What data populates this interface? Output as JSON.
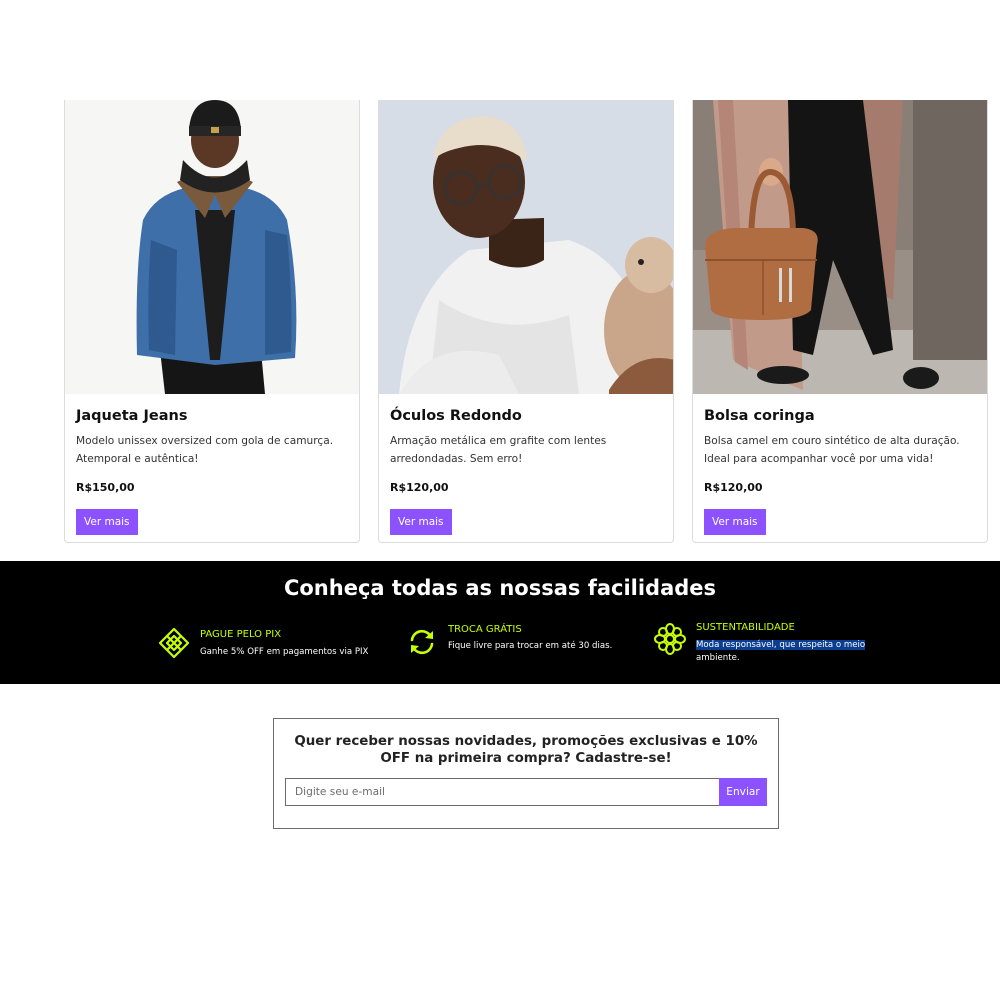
{
  "products": [
    {
      "title": "Jaqueta Jeans",
      "description": "Modelo unissex oversized com gola de camurça. Atemporal e autêntica!",
      "price": "R$150,00",
      "button_label": "Ver mais",
      "image_alt": "Homem com jaqueta jeans e gorro preto"
    },
    {
      "title": "Óculos Redondo",
      "description": "Armação metálica em grafite com lentes arredondadas. Sem erro!",
      "price": "R$120,00",
      "button_label": "Ver mais",
      "image_alt": "Homem de óculos redondos com camiseta branca e cachorro"
    },
    {
      "title": "Bolsa coringa",
      "description": "Bolsa camel em couro sintético de alta duração. Ideal para acompanhar você por uma vida!",
      "price": "R$120,00",
      "button_label": "Ver mais",
      "image_alt": "Pessoa segurando bolsa camel"
    }
  ],
  "benefits": {
    "title": "Conheça todas as nossas facilidades",
    "items": [
      {
        "icon": "pix-icon",
        "title": "PAGUE PELO PIX",
        "description": "Ganhe 5% OFF em pagamentos via PIX"
      },
      {
        "icon": "exchange-icon",
        "title": "TROCA GRÁTIS",
        "description": "Fique livre para trocar em até 30 dias."
      },
      {
        "icon": "sustainability-flower-icon",
        "title": "SUSTENTABILIDADE",
        "description_highlighted": "Moda responsável, que respeita o meio",
        "description_rest": "ambiente."
      }
    ]
  },
  "newsletter": {
    "text": "Quer receber nossas novidades, promoções exclusivas e 10% OFF na primeira compra? Cadastre-se!",
    "input_placeholder": "Digite seu e-mail",
    "input_value": "",
    "submit_label": "Enviar"
  },
  "colors": {
    "accent": "#8c52ff",
    "band_background": "#000000",
    "benefit_green": "#c6ff00",
    "text_highlight": "#0b3d91"
  }
}
